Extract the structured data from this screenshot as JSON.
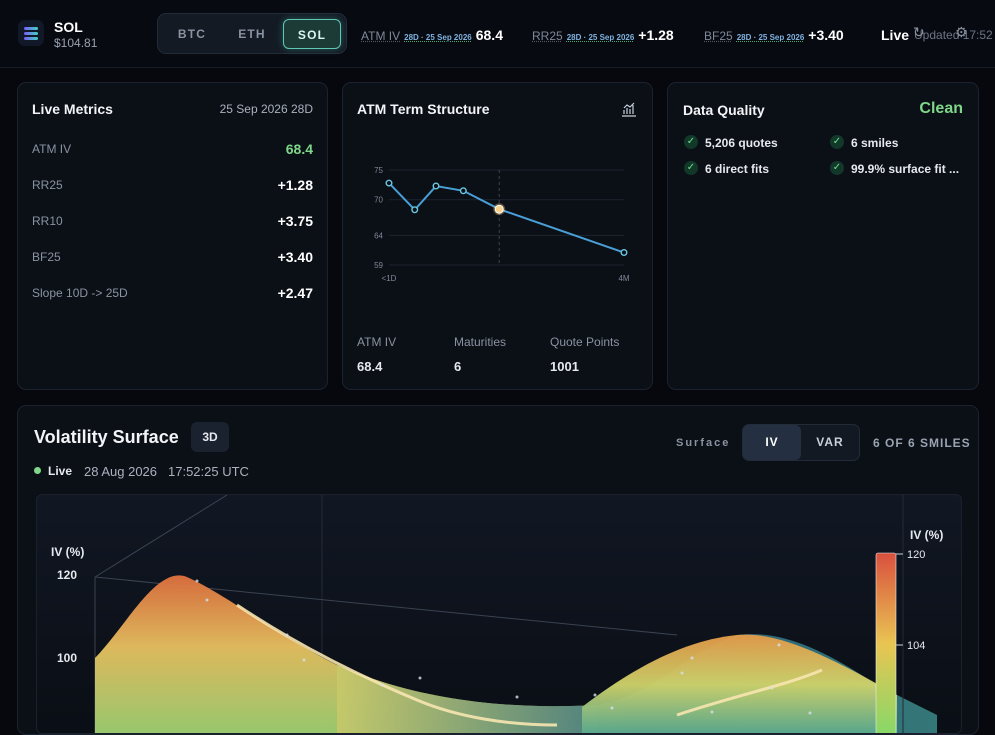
{
  "header": {
    "asset": "SOL",
    "price": "$104.81",
    "tabs": [
      "BTC",
      "ETH",
      "SOL"
    ],
    "tickers": [
      {
        "label": "ATM IV",
        "sub": "28D · 25 Sep 2026",
        "value": "68.4"
      },
      {
        "label": "RR25",
        "sub": "28D · 25 Sep 2026",
        "value": "+1.28"
      },
      {
        "label": "BF25",
        "sub": "28D · 25 Sep 2026",
        "value": "+3.40"
      }
    ],
    "status": "Live",
    "updated": "Updated 17:52"
  },
  "live_metrics": {
    "title": "Live Metrics",
    "context": "25 Sep 2026 28D",
    "rows": [
      {
        "label": "ATM IV",
        "value": "68.4"
      },
      {
        "label": "RR25",
        "value": "+1.28"
      },
      {
        "label": "RR10",
        "value": "+3.75"
      },
      {
        "label": "BF25",
        "value": "+3.40"
      },
      {
        "label": "Slope 10D -> 25D",
        "value": "+2.47"
      }
    ]
  },
  "term": {
    "title": "ATM Term Structure",
    "stats": [
      {
        "label": "ATM IV",
        "value": "68.4"
      },
      {
        "label": "Maturities",
        "value": "6"
      },
      {
        "label": "Quote Points",
        "value": "1001"
      }
    ]
  },
  "chart_data": {
    "type": "line",
    "yticks": [
      "75",
      "70",
      "64",
      "59"
    ],
    "xticks": [
      "<1D",
      "4M"
    ],
    "ylim": [
      59,
      75
    ],
    "series": [
      {
        "values": [
          {
            "x": 0,
            "y": 72.8
          },
          {
            "x": 0.3,
            "y": 68.3
          },
          {
            "x": 1,
            "y": 72.3
          },
          {
            "x": 2.5,
            "y": 71.5
          },
          {
            "x": 5.5,
            "y": 68.4
          },
          {
            "x": 25,
            "y": 61.1
          }
        ]
      }
    ],
    "highlight_index": 4,
    "crosshair_x": 5.5,
    "x_max": 25
  },
  "quality": {
    "title": "Data Quality",
    "status": "Clean",
    "items": [
      "5,206 quotes",
      "6 smiles",
      "6 direct fits",
      "99.9% surface fit ..."
    ]
  },
  "surface": {
    "title": "Volatility Surface",
    "mode_badge": "3D",
    "status": "Live",
    "date": "28 Aug 2026",
    "time": "17:52:25 UTC",
    "toggle_label": "Surface",
    "options": [
      "IV",
      "VAR"
    ],
    "count": "6 OF 6 SMILES",
    "z_label": "IV (%)",
    "z_ticks": [
      "120",
      "100"
    ],
    "legend_title": "IV (%)",
    "legend_ticks": [
      "120",
      "104"
    ]
  },
  "colors": {
    "accent": "#5cc9b4",
    "good": "#7fd88a",
    "line": "#4a9fd6"
  }
}
